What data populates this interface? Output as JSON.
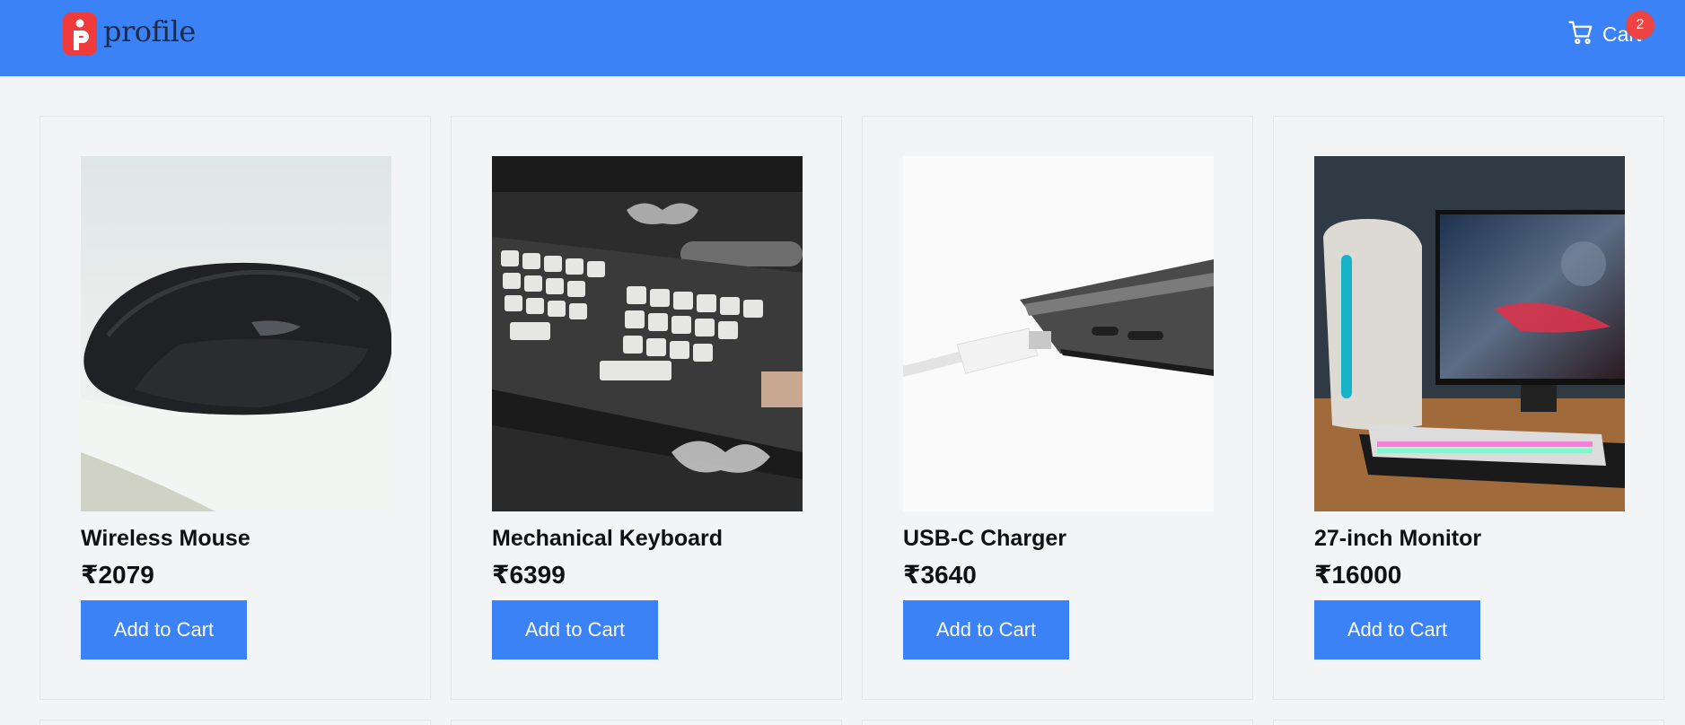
{
  "header": {
    "brand_name": "profile",
    "cart_label": "Cart",
    "cart_count": "2"
  },
  "colors": {
    "primary": "#3b82f6",
    "badge": "#ef4444",
    "logo": "#ef3b3b"
  },
  "products": [
    {
      "name": "Wireless Mouse",
      "price": "₹2079",
      "button": "Add to Cart",
      "image_icon": "mouse-image"
    },
    {
      "name": "Mechanical Keyboard",
      "price": "₹6399",
      "button": "Add to Cart",
      "image_icon": "keyboard-image"
    },
    {
      "name": "USB-C Charger",
      "price": "₹3640",
      "button": "Add to Cart",
      "image_icon": "charger-image"
    },
    {
      "name": "27-inch Monitor",
      "price": "₹16000",
      "button": "Add to Cart",
      "image_icon": "monitor-image"
    }
  ]
}
